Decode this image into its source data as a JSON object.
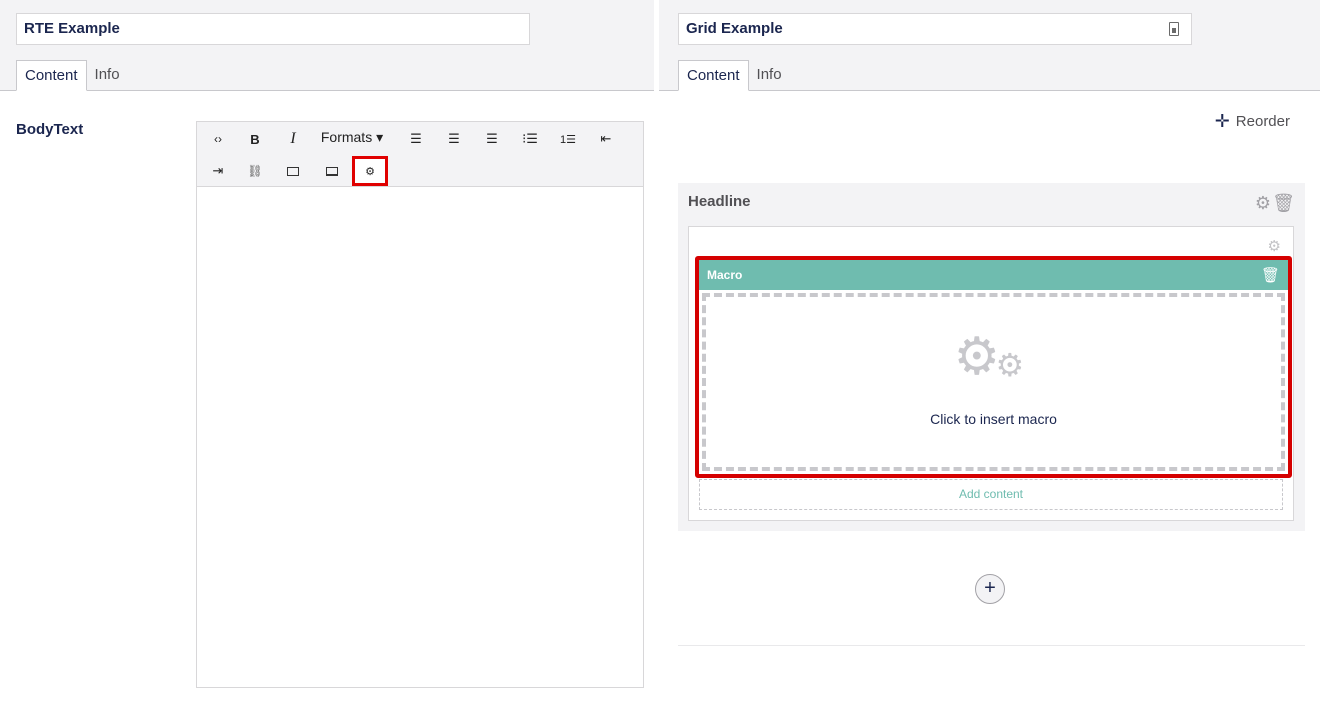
{
  "left": {
    "name_value": "RTE Example",
    "tabs": [
      {
        "label": "Content"
      },
      {
        "label": "Info"
      }
    ],
    "property_label": "BodyText",
    "toolbar": {
      "buttons": [
        {
          "name": "source-code",
          "glyph": "‹›"
        },
        {
          "name": "bold",
          "glyph": "B"
        },
        {
          "name": "italic",
          "glyph": "I"
        },
        {
          "name": "formats",
          "glyph": "Formats ▾"
        },
        {
          "name": "align-left",
          "glyph": "≡"
        },
        {
          "name": "align-center",
          "glyph": "≡"
        },
        {
          "name": "align-right",
          "glyph": "≡"
        },
        {
          "name": "bullet-list",
          "glyph": "☰"
        },
        {
          "name": "numbered-list",
          "glyph": "☰"
        },
        {
          "name": "outdent",
          "glyph": "⇤"
        },
        {
          "name": "indent",
          "glyph": "⇥"
        },
        {
          "name": "link",
          "glyph": "🔗"
        },
        {
          "name": "image",
          "glyph": "▣"
        },
        {
          "name": "embed",
          "glyph": "▭"
        },
        {
          "name": "insert-macro",
          "glyph": "⚙"
        }
      ],
      "highlight_color": "#e00000"
    }
  },
  "right": {
    "name_value": "Grid Example",
    "tabs": [
      {
        "label": "Content"
      },
      {
        "label": "Info"
      }
    ],
    "reorder_label": "Reorder",
    "row_title": "Headline",
    "macro_title": "Macro",
    "macro_placeholder": "Click to insert macro",
    "add_content_label": "Add content",
    "add_row_glyph": "+",
    "accent_color": "#6fbcaf",
    "highlight_color": "#d50000"
  }
}
